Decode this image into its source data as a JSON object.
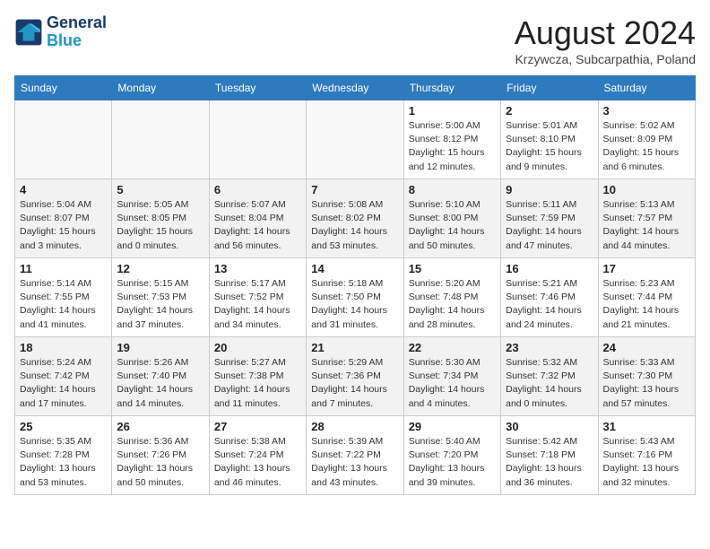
{
  "header": {
    "logo_line1": "General",
    "logo_line2": "Blue",
    "month": "August 2024",
    "location": "Krzywcza, Subcarpathia, Poland"
  },
  "weekdays": [
    "Sunday",
    "Monday",
    "Tuesday",
    "Wednesday",
    "Thursday",
    "Friday",
    "Saturday"
  ],
  "weeks": [
    [
      {
        "day": "",
        "info": ""
      },
      {
        "day": "",
        "info": ""
      },
      {
        "day": "",
        "info": ""
      },
      {
        "day": "",
        "info": ""
      },
      {
        "day": "1",
        "info": "Sunrise: 5:00 AM\nSunset: 8:12 PM\nDaylight: 15 hours\nand 12 minutes."
      },
      {
        "day": "2",
        "info": "Sunrise: 5:01 AM\nSunset: 8:10 PM\nDaylight: 15 hours\nand 9 minutes."
      },
      {
        "day": "3",
        "info": "Sunrise: 5:02 AM\nSunset: 8:09 PM\nDaylight: 15 hours\nand 6 minutes."
      }
    ],
    [
      {
        "day": "4",
        "info": "Sunrise: 5:04 AM\nSunset: 8:07 PM\nDaylight: 15 hours\nand 3 minutes."
      },
      {
        "day": "5",
        "info": "Sunrise: 5:05 AM\nSunset: 8:05 PM\nDaylight: 15 hours\nand 0 minutes."
      },
      {
        "day": "6",
        "info": "Sunrise: 5:07 AM\nSunset: 8:04 PM\nDaylight: 14 hours\nand 56 minutes."
      },
      {
        "day": "7",
        "info": "Sunrise: 5:08 AM\nSunset: 8:02 PM\nDaylight: 14 hours\nand 53 minutes."
      },
      {
        "day": "8",
        "info": "Sunrise: 5:10 AM\nSunset: 8:00 PM\nDaylight: 14 hours\nand 50 minutes."
      },
      {
        "day": "9",
        "info": "Sunrise: 5:11 AM\nSunset: 7:59 PM\nDaylight: 14 hours\nand 47 minutes."
      },
      {
        "day": "10",
        "info": "Sunrise: 5:13 AM\nSunset: 7:57 PM\nDaylight: 14 hours\nand 44 minutes."
      }
    ],
    [
      {
        "day": "11",
        "info": "Sunrise: 5:14 AM\nSunset: 7:55 PM\nDaylight: 14 hours\nand 41 minutes."
      },
      {
        "day": "12",
        "info": "Sunrise: 5:15 AM\nSunset: 7:53 PM\nDaylight: 14 hours\nand 37 minutes."
      },
      {
        "day": "13",
        "info": "Sunrise: 5:17 AM\nSunset: 7:52 PM\nDaylight: 14 hours\nand 34 minutes."
      },
      {
        "day": "14",
        "info": "Sunrise: 5:18 AM\nSunset: 7:50 PM\nDaylight: 14 hours\nand 31 minutes."
      },
      {
        "day": "15",
        "info": "Sunrise: 5:20 AM\nSunset: 7:48 PM\nDaylight: 14 hours\nand 28 minutes."
      },
      {
        "day": "16",
        "info": "Sunrise: 5:21 AM\nSunset: 7:46 PM\nDaylight: 14 hours\nand 24 minutes."
      },
      {
        "day": "17",
        "info": "Sunrise: 5:23 AM\nSunset: 7:44 PM\nDaylight: 14 hours\nand 21 minutes."
      }
    ],
    [
      {
        "day": "18",
        "info": "Sunrise: 5:24 AM\nSunset: 7:42 PM\nDaylight: 14 hours\nand 17 minutes."
      },
      {
        "day": "19",
        "info": "Sunrise: 5:26 AM\nSunset: 7:40 PM\nDaylight: 14 hours\nand 14 minutes."
      },
      {
        "day": "20",
        "info": "Sunrise: 5:27 AM\nSunset: 7:38 PM\nDaylight: 14 hours\nand 11 minutes."
      },
      {
        "day": "21",
        "info": "Sunrise: 5:29 AM\nSunset: 7:36 PM\nDaylight: 14 hours\nand 7 minutes."
      },
      {
        "day": "22",
        "info": "Sunrise: 5:30 AM\nSunset: 7:34 PM\nDaylight: 14 hours\nand 4 minutes."
      },
      {
        "day": "23",
        "info": "Sunrise: 5:32 AM\nSunset: 7:32 PM\nDaylight: 14 hours\nand 0 minutes."
      },
      {
        "day": "24",
        "info": "Sunrise: 5:33 AM\nSunset: 7:30 PM\nDaylight: 13 hours\nand 57 minutes."
      }
    ],
    [
      {
        "day": "25",
        "info": "Sunrise: 5:35 AM\nSunset: 7:28 PM\nDaylight: 13 hours\nand 53 minutes."
      },
      {
        "day": "26",
        "info": "Sunrise: 5:36 AM\nSunset: 7:26 PM\nDaylight: 13 hours\nand 50 minutes."
      },
      {
        "day": "27",
        "info": "Sunrise: 5:38 AM\nSunset: 7:24 PM\nDaylight: 13 hours\nand 46 minutes."
      },
      {
        "day": "28",
        "info": "Sunrise: 5:39 AM\nSunset: 7:22 PM\nDaylight: 13 hours\nand 43 minutes."
      },
      {
        "day": "29",
        "info": "Sunrise: 5:40 AM\nSunset: 7:20 PM\nDaylight: 13 hours\nand 39 minutes."
      },
      {
        "day": "30",
        "info": "Sunrise: 5:42 AM\nSunset: 7:18 PM\nDaylight: 13 hours\nand 36 minutes."
      },
      {
        "day": "31",
        "info": "Sunrise: 5:43 AM\nSunset: 7:16 PM\nDaylight: 13 hours\nand 32 minutes."
      }
    ]
  ]
}
